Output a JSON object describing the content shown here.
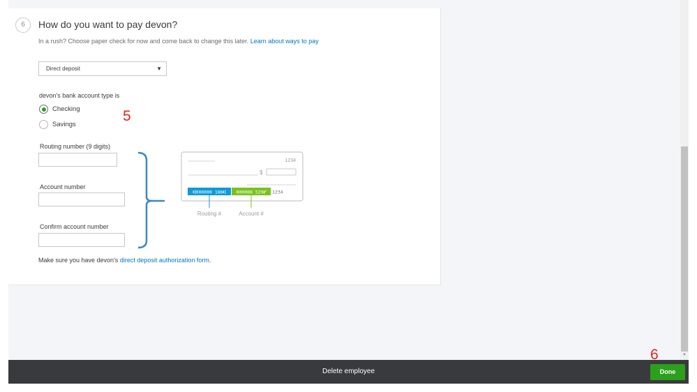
{
  "step": {
    "number": "6",
    "title": "How do you want to pay devon?",
    "subtitle": "In a rush? Choose paper check for now and come back to change this later.",
    "subtitle_link": "Learn about ways to pay"
  },
  "payment_method": {
    "selected": "Direct deposit"
  },
  "bank_account": {
    "label": "devon's bank account type is",
    "options": [
      {
        "label": "Checking",
        "checked": true
      },
      {
        "label": "Savings",
        "checked": false
      }
    ]
  },
  "fields": {
    "routing_label": "Routing number (9 digits)",
    "routing_value": "",
    "account_label": "Account number",
    "account_value": "",
    "confirm_label": "Confirm account number",
    "confirm_value": ""
  },
  "check_illustration": {
    "check_number": "1234",
    "dollar_sign": "$",
    "routing_micr": "⑆000000 186⑆",
    "account_micr": "000000 529⑈",
    "check_micr": "1234",
    "routing_caption": "Routing #",
    "account_caption": "Account #",
    "routing_color": "#0f9ad8",
    "account_color": "#7ac21e"
  },
  "note": {
    "text": "Make sure you have devon's",
    "link": "direct deposit authorization form",
    "end": "."
  },
  "annotations": {
    "five": "5",
    "six": "6"
  },
  "footer": {
    "delete_label": "Delete employee",
    "done_label": "Done"
  },
  "colors": {
    "accent_green": "#2ca01c",
    "link_blue": "#0077c5",
    "bracket_blue": "#3a86c8",
    "annotation_red": "#e8221b",
    "footer_bg": "#393a3d"
  }
}
